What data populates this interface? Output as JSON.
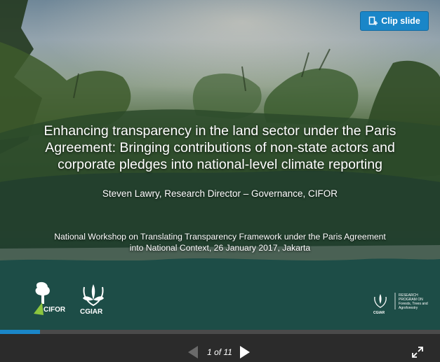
{
  "slide": {
    "title_lines": [
      "Enhancing transparency in the land sector under the Paris",
      "Agreement: Bringing contributions of non-state actors and",
      "corporate pledges into national-level climate reporting"
    ],
    "author": "Steven Lawry, Research Director – Governance, CIFOR",
    "event_lines": [
      "National Workshop on Translating Transparency Framework under the Paris Agreement",
      "into National Context, 26 January 2017, Jakarta"
    ],
    "logos": {
      "cifor": "CIFOR",
      "cgiar": "CGIAR",
      "ftam_cgiar": "CGIAR",
      "ftam_lines": [
        "RESEARCH",
        "PROGRAM ON",
        "Forests, Trees and",
        "Agroforestry"
      ]
    }
  },
  "clip_button": {
    "label": "Clip slide",
    "icon": "clip-icon"
  },
  "player": {
    "counter": "1 of 11",
    "current": 1,
    "total": 11,
    "progress_fraction": 0.0909,
    "prev_icon": "triangle-left-icon",
    "next_icon": "triangle-right-icon",
    "fullscreen_icon": "expand-icon"
  },
  "colors": {
    "accent": "#1a86c8",
    "bar_bg": "#2b2b2b",
    "teal_band": "#1d4d47"
  }
}
